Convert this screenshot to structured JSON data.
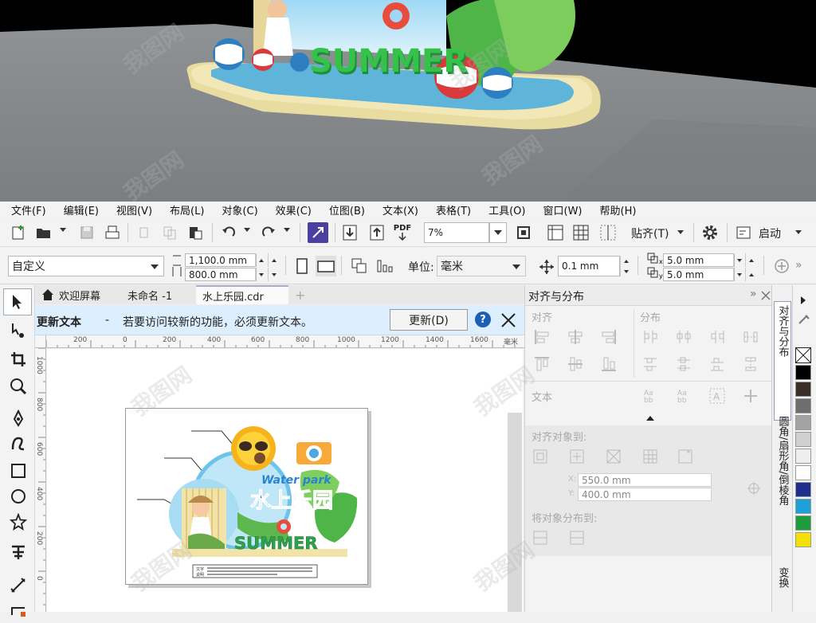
{
  "render": {
    "sign_text": "SUMMER"
  },
  "menu": [
    {
      "label": "文件(F)"
    },
    {
      "label": "编辑(E)"
    },
    {
      "label": "视图(V)"
    },
    {
      "label": "布局(L)"
    },
    {
      "label": "对象(C)"
    },
    {
      "label": "效果(C)"
    },
    {
      "label": "位图(B)"
    },
    {
      "label": "文本(X)"
    },
    {
      "label": "表格(T)"
    },
    {
      "label": "工具(O)"
    },
    {
      "label": "窗口(W)"
    },
    {
      "label": "帮助(H)"
    }
  ],
  "toolbar": {
    "pdf_label": "PDF",
    "zoom_value": "7%",
    "snap_label": "贴齐(T)",
    "launch_label": "启动"
  },
  "propbar": {
    "page_preset": "自定义",
    "width": "1,100.0 mm",
    "height": "800.0 mm",
    "unit_label": "单位:",
    "unit_value": "毫米",
    "nudge": "0.1 mm",
    "dup_x": "5.0 mm",
    "dup_y": "5.0 mm"
  },
  "tabs": [
    {
      "label": "欢迎屏幕"
    },
    {
      "label": "未命名 -1"
    },
    {
      "label": "水上乐园.cdr"
    }
  ],
  "notification": {
    "title": "更新文本",
    "separator": "-",
    "message": "若要访问较新的功能，必须更新文本。",
    "button": "更新(D)"
  },
  "rulers": {
    "h_ticks": [
      "200",
      "0",
      "200",
      "400",
      "600",
      "800",
      "1000",
      "1200",
      "1400",
      "1600",
      "毫米"
    ],
    "v_ticks": [
      "1000",
      "800",
      "600",
      "400",
      "200",
      "0"
    ]
  },
  "artwork": {
    "line1": "Water park",
    "line2": "水上乐园",
    "word": "SUMMER",
    "caption_a": "文字",
    "caption_b": "说明"
  },
  "docker": {
    "title": "对齐与分布",
    "align_label": "对齐",
    "distribute_label": "分布",
    "text_label": "文本",
    "align_to_label": "对齐对象到:",
    "x_label": "X:",
    "x_value": "550.0 mm",
    "y_label": "Y:",
    "y_value": "400.0 mm",
    "distribute_to_label": "将对象分布到:"
  },
  "vtabs": [
    {
      "label": "对齐与分布"
    },
    {
      "label": "圆角/扇形角/倒棱角"
    },
    {
      "label": "变换"
    }
  ],
  "palette": [
    "#000000",
    "#3a2c26",
    "#6e6e6e",
    "#a3a3a3",
    "#cfcfcf",
    "#eeeeee",
    "#ffffff",
    "#1f2d8c",
    "#1ea0d8",
    "#1e9b3b",
    "#f4e100"
  ],
  "watermark": "我图网"
}
